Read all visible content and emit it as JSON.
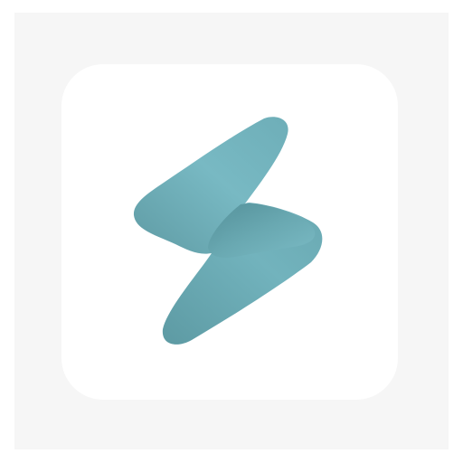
{
  "app_icon": {
    "icon": "lightning-bolt-icon",
    "colors": {
      "page_background": "#ffffff",
      "backdrop": "#f6f6f6",
      "tile": "#ffffff",
      "bolt_light": "#7bbcc6",
      "bolt_mid": "#69aab3",
      "bolt_dark": "#4f8d96"
    }
  }
}
